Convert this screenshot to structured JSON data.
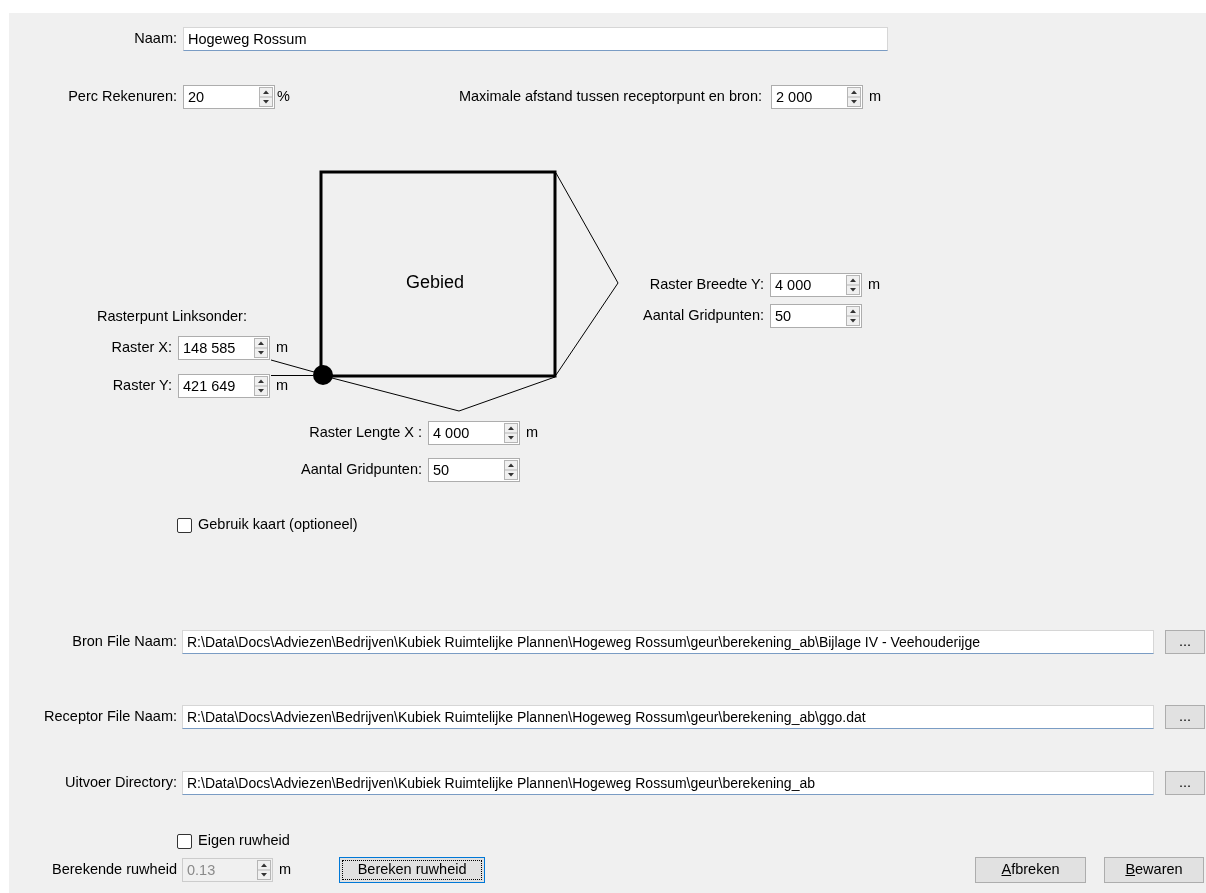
{
  "naam": {
    "label": "Naam:",
    "value": "Hogeweg Rossum"
  },
  "perc_rekenuren": {
    "label": "Perc Rekenuren:",
    "value": "20",
    "unit": "%"
  },
  "max_afstand": {
    "label": "Maximale afstand tussen receptorpunt en bron:",
    "value": "2 000",
    "unit": "m"
  },
  "diagram": {
    "area_label": "Gebied",
    "origin_heading": "Rasterpunt Linksonder:",
    "raster_x": {
      "label": "Raster X:",
      "value": "148 585",
      "unit": "m"
    },
    "raster_y": {
      "label": "Raster Y:",
      "value": "421 649",
      "unit": "m"
    },
    "breedte_y": {
      "label": "Raster Breedte Y:",
      "value": "4 000",
      "unit": "m"
    },
    "gridpunten_y": {
      "label": "Aantal Gridpunten:",
      "value": "50"
    },
    "lengte_x": {
      "label": "Raster Lengte X :",
      "value": "4 000",
      "unit": "m"
    },
    "gridpunten_x": {
      "label": "Aantal Gridpunten:",
      "value": "50"
    }
  },
  "gebruik_kaart": {
    "label": "Gebruik kaart (optioneel)",
    "checked": false
  },
  "files": [
    {
      "label": "Bron File Naam:",
      "value": "R:\\Data\\Docs\\Adviezen\\Bedrijven\\Kubiek Ruimtelijke Plannen\\Hogeweg Rossum\\geur\\berekening_ab\\Bijlage IV - Veehouderijge",
      "button": "..."
    },
    {
      "label": "Receptor File Naam:",
      "value": "R:\\Data\\Docs\\Adviezen\\Bedrijven\\Kubiek Ruimtelijke Plannen\\Hogeweg Rossum\\geur\\berekening_ab\\ggo.dat",
      "button": "..."
    },
    {
      "label": "Uitvoer Directory:",
      "value": "R:\\Data\\Docs\\Adviezen\\Bedrijven\\Kubiek Ruimtelijke Plannen\\Hogeweg Rossum\\geur\\berekening_ab",
      "button": "..."
    }
  ],
  "eigen_ruwheid": {
    "label": "Eigen ruwheid",
    "checked": false
  },
  "berekende_ruwheid": {
    "label": "Berekende ruwheid",
    "value": "0.13",
    "unit": "m",
    "disabled": true
  },
  "buttons": [
    {
      "label": "Bereken ruwheid",
      "focused": true,
      "underline_first": false
    },
    {
      "label": "Afbreken",
      "focused": false,
      "underline_first": true
    },
    {
      "label": "Bewaren",
      "focused": false,
      "underline_first": true
    }
  ]
}
